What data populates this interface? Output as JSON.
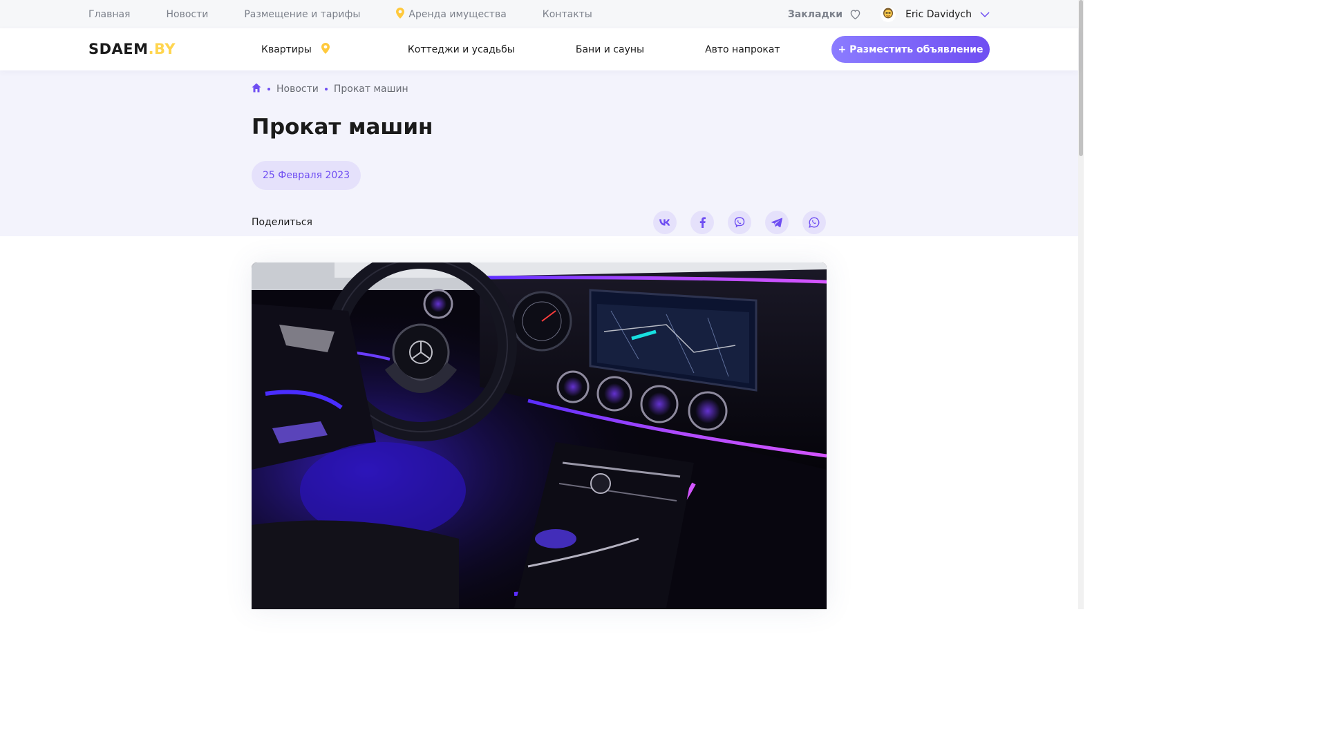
{
  "topbar": {
    "links": [
      "Главная",
      "Новости",
      "Размещение и тарифы",
      "Аренда имущества",
      "Контакты"
    ],
    "bookmarks_label": "Закладки",
    "user_name": "Eric Davidych"
  },
  "header": {
    "logo_main": "SDAEM",
    "logo_suffix": ".BY",
    "nav": [
      "Квартиры",
      "Коттеджи и усадьбы",
      "Бани и сауны",
      "Авто напрокат"
    ],
    "post_button": "+ Разместить объявление"
  },
  "breadcrumb": {
    "items": [
      "Новости",
      "Прокат машин"
    ]
  },
  "article": {
    "title": "Прокат машин",
    "date": "25 Февраля 2023",
    "share_label": "Поделиться",
    "socials": [
      "vk-icon",
      "facebook-icon",
      "viber-icon",
      "telegram-icon",
      "whatsapp-icon"
    ]
  },
  "colors": {
    "accent": "#6f4ef2",
    "accent_light": "#e5e1fb",
    "logo_yellow": "#ffd54f",
    "hero_bg": "#f3f3fc"
  }
}
